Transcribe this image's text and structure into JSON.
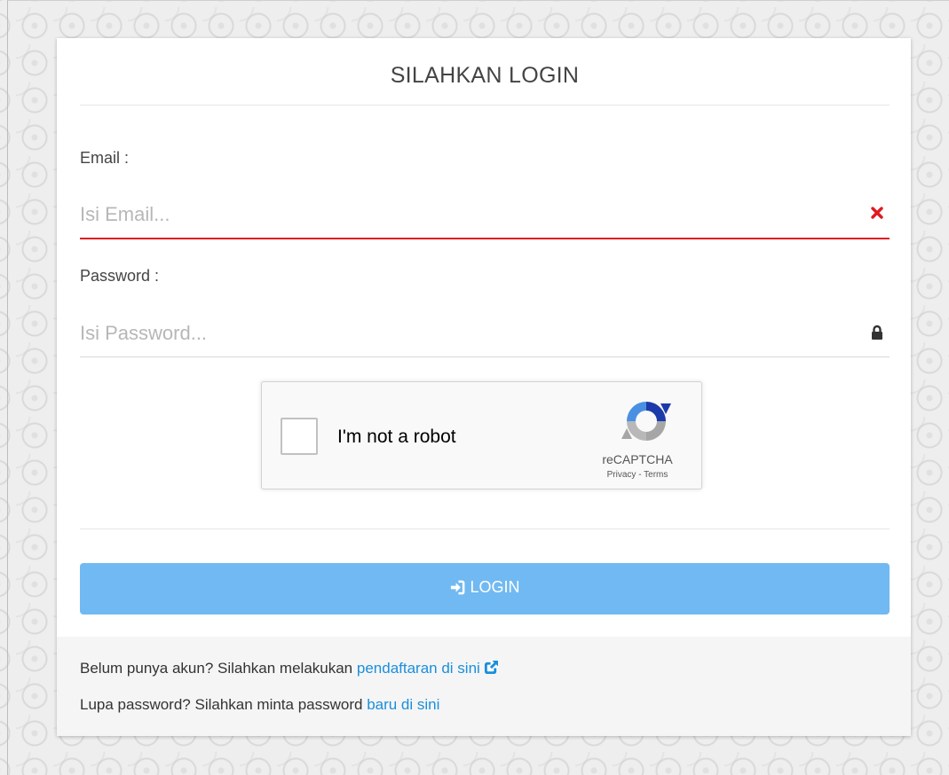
{
  "page": {
    "title": "SILAHKAN LOGIN"
  },
  "email": {
    "label": "Email :",
    "placeholder": "Isi Email...",
    "value": "",
    "status_icon": "times-icon",
    "error_color": "#e0191f"
  },
  "password": {
    "label": "Password :",
    "placeholder": "Isi Password...",
    "value": "",
    "icon": "lock-icon"
  },
  "captcha": {
    "label": "I'm not a robot",
    "brand": "reCAPTCHA",
    "privacy": "Privacy",
    "separator": " - ",
    "terms": "Terms",
    "checked": false
  },
  "login_button": {
    "label": "LOGIN",
    "icon": "sign-in-icon",
    "color": "#71b9f2"
  },
  "footer": {
    "register_prefix": "Belum punya akun? Silahkan melakukan ",
    "register_link": "pendaftaran di sini",
    "register_icon": "external-link-icon",
    "forgot_prefix": "Lupa password? Silahkan minta password ",
    "forgot_link": "baru di sini",
    "link_color": "#1a8fdc"
  }
}
